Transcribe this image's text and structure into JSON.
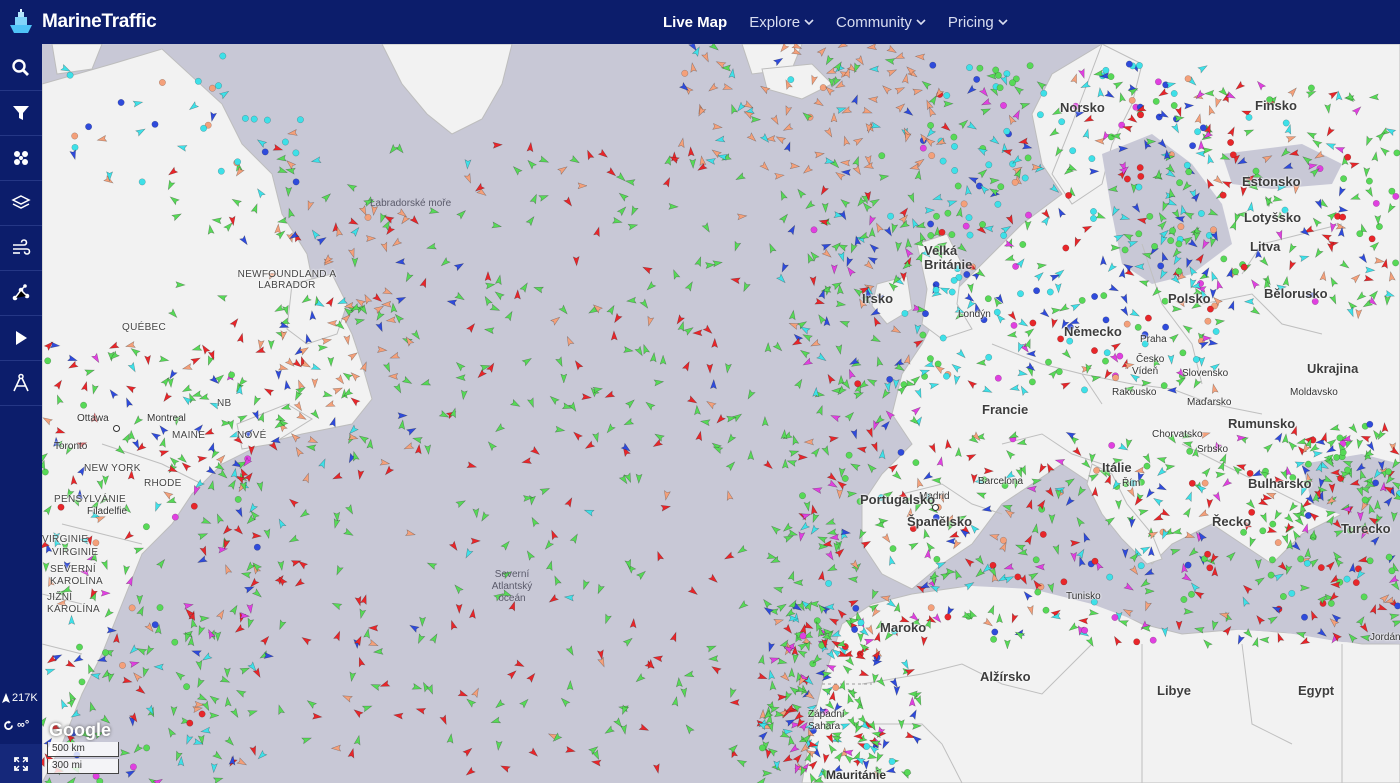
{
  "brand": {
    "name": "MarineTraffic",
    "logo_icon": "ship-logo-icon"
  },
  "nav": [
    {
      "label": "Live Map",
      "active": true,
      "dropdown": false
    },
    {
      "label": "Explore",
      "active": false,
      "dropdown": true
    },
    {
      "label": "Community",
      "active": false,
      "dropdown": true
    },
    {
      "label": "Pricing",
      "active": false,
      "dropdown": true
    }
  ],
  "sidebar": {
    "tools": [
      {
        "name": "search-tool",
        "icon": "search-icon"
      },
      {
        "name": "filter-tool",
        "icon": "filter-icon"
      },
      {
        "name": "density-tool",
        "icon": "density-icon"
      },
      {
        "name": "layers-tool",
        "icon": "layers-icon"
      },
      {
        "name": "weather-tool",
        "icon": "wind-icon"
      },
      {
        "name": "routes-tool",
        "icon": "routes-icon"
      },
      {
        "name": "playback-tool",
        "icon": "play-icon"
      },
      {
        "name": "measure-tool",
        "icon": "measure-icon"
      }
    ],
    "vessel_count": "217K",
    "live_label": "∞°"
  },
  "map": {
    "attribution": "Google",
    "scale": [
      "500 km",
      "300 mi"
    ],
    "labels": {
      "labrador_sea": "Labradorské moře",
      "newfoundland": "NEWFOUNDLAND A LABRADOR",
      "quebec": "QUÉBEC",
      "ottawa": "Ottawa",
      "montreal": "Montreal",
      "toronto": "Toronto",
      "nb": "NB",
      "maine": "MAINE",
      "nova": "NOVÉ",
      "new_york": "NEW YORK",
      "pennsylvania": "PENSYLVÁNIE",
      "rhode": "RHODE",
      "philadelphia": "Filadelfie",
      "virginia": "VIRGINIE",
      "virginia2": "VIRGINIE",
      "north_carolina": "SEVERNÍ KAROLÍNA",
      "south_carolina": "JIŽNÍ KAROLÍNA",
      "atlantic": "Severní Atlantský oceán",
      "norway": "Norsko",
      "finland": "Finsko",
      "estonia": "Estonsko",
      "latvia": "Lotyšsko",
      "lithuania": "Litva",
      "uk": "Velká Británie",
      "ireland": "Irsko",
      "london": "Londýn",
      "poland": "Polsko",
      "belarus": "Bělorusko",
      "germany": "Německo",
      "prague": "Praha",
      "czech": "Česko",
      "vienna": "Vídeň",
      "slovakia": "Slovensko",
      "austria": "Rakousko",
      "hungary": "Maďarsko",
      "ukraine": "Ukrajina",
      "moldova": "Moldavsko",
      "romania": "Rumunsko",
      "france": "Francie",
      "croatia": "Chorvatsko",
      "serbia": "Srbsko",
      "italy": "Itálie",
      "rome": "Řím",
      "bulgaria": "Bulharsko",
      "turkey": "Turecko",
      "barcelona": "Barcelona",
      "madrid": "Madrid",
      "spain": "Španělsko",
      "portugal": "Portugalsko",
      "greece": "Řecko",
      "tunisia": "Tunisko",
      "morocco": "Maroko",
      "algeria": "Alžírsko",
      "libya": "Libye",
      "egypt": "Egypt",
      "jordan": "Jordánsko",
      "western_sahara": "Západní Sahara",
      "mauritania": "Mauritánie"
    },
    "vessel_colors": {
      "cargo": "#57d957",
      "tanker": "#e8262a",
      "passenger": "#2f4bdb",
      "fishing": "#f4a07a",
      "tug": "#3ee0e8",
      "pleasure": "#e040e0",
      "other": "#c9c9c9"
    }
  }
}
